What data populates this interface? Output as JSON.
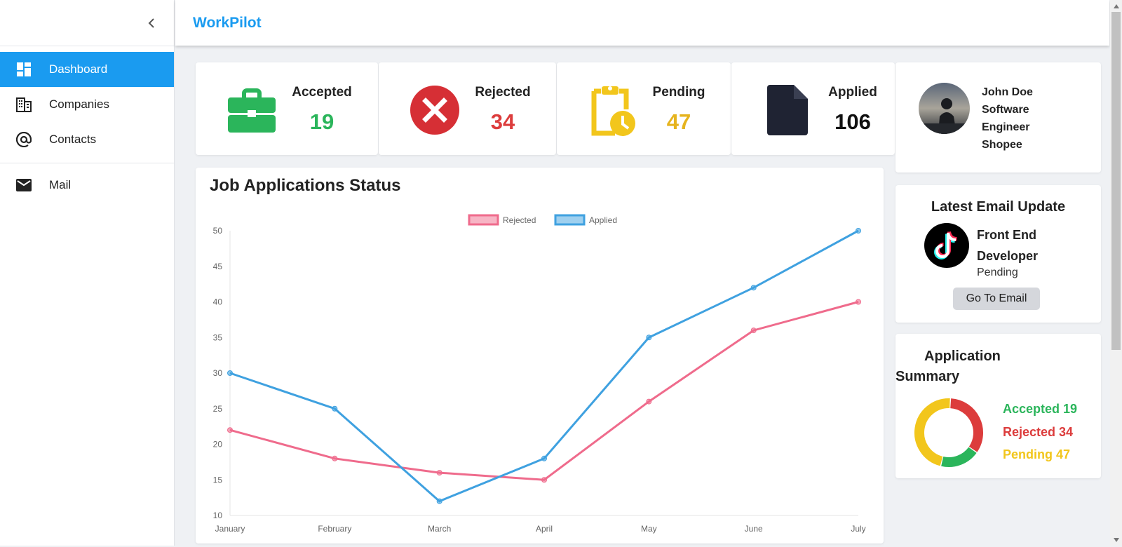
{
  "app": {
    "brand": "WorkPilot"
  },
  "sidebar": {
    "items": [
      {
        "label": "Dashboard",
        "icon": "dashboard-icon",
        "active": true
      },
      {
        "label": "Companies",
        "icon": "building-icon"
      },
      {
        "label": "Contacts",
        "icon": "at-sign-icon"
      },
      {
        "label": "Mail",
        "icon": "mail-icon"
      }
    ]
  },
  "stats": [
    {
      "label": "Accepted",
      "value": "19",
      "color": "#2bb55b",
      "icon": "briefcase-icon"
    },
    {
      "label": "Rejected",
      "value": "34",
      "color": "#dc3c3c",
      "icon": "close-circle-icon"
    },
    {
      "label": "Pending",
      "value": "47",
      "color": "#e6b41e",
      "icon": "clipboard-clock-icon"
    },
    {
      "label": "Applied",
      "value": "106",
      "color": "#1f2333",
      "icon": "file-icon"
    }
  ],
  "profile": {
    "name_lines": [
      "John Doe",
      "Software",
      "Engineer",
      "Shopee"
    ]
  },
  "email_update": {
    "title": "Latest Email Update",
    "role_lines": [
      "Front End",
      "Developer"
    ],
    "status": "Pending",
    "button": "Go To Email",
    "icon": "tiktok-logo"
  },
  "summary": {
    "title_lines": [
      "Application",
      "Summary"
    ],
    "lines": [
      {
        "text": "Accepted 19",
        "color": "#2bb55b"
      },
      {
        "text": "Rejected 34",
        "color": "#dc3c3c"
      },
      {
        "text": "Pending 47",
        "color": "#f2c61c"
      }
    ],
    "donut": [
      {
        "label": "Accepted",
        "value": 19,
        "color": "#2bb55b"
      },
      {
        "label": "Rejected",
        "value": 34,
        "color": "#dc3c3c"
      },
      {
        "label": "Pending",
        "value": 47,
        "color": "#f2c61c"
      }
    ]
  },
  "chart_data": {
    "type": "line",
    "title": "Job Applications Status",
    "categories": [
      "January",
      "February",
      "March",
      "April",
      "May",
      "June",
      "July"
    ],
    "series": [
      {
        "name": "Rejected",
        "values": [
          22,
          18,
          16,
          15,
          26,
          36,
          40
        ],
        "color": "#ef6b8c"
      },
      {
        "name": "Applied",
        "values": [
          30,
          25,
          12,
          18,
          35,
          42,
          50
        ],
        "color": "#3fa1e0"
      }
    ],
    "ylim": [
      10,
      50
    ],
    "yticks": [
      10,
      15,
      20,
      25,
      30,
      35,
      40,
      45,
      50
    ],
    "legend": "top-center",
    "grid": false
  }
}
